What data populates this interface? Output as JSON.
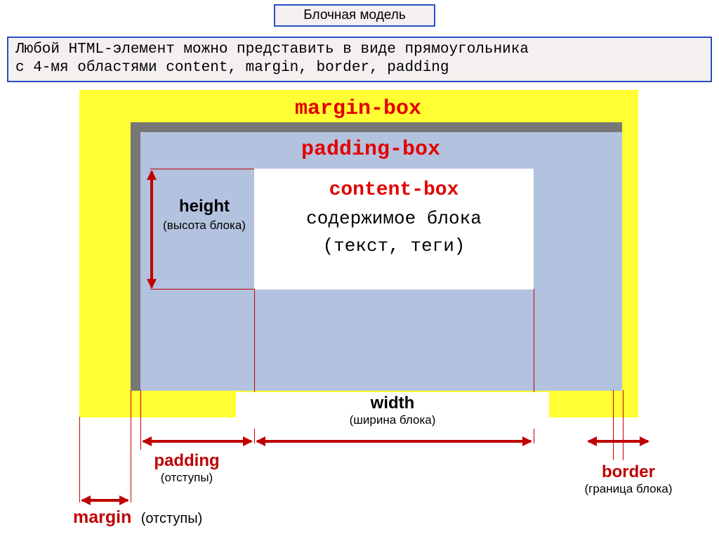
{
  "title": "Блочная модель",
  "description_line1": "Любой HTML-элемент можно представить в виде прямоугольника",
  "description_line2_prefix": "с 4-мя областями  ",
  "description_line2_terms": "content,  margin, border, padding",
  "labels": {
    "margin_box": "margin-box",
    "padding_box": "padding-box",
    "content_box_title": "content-box",
    "content_box_line1": "содержимое блока",
    "content_box_line2": "(текст, теги)"
  },
  "annotations": {
    "height": {
      "term": "height",
      "note": "(высота блока)"
    },
    "width": {
      "term": "width",
      "note": "(ширина блока)"
    },
    "padding": {
      "term": "padding",
      "note": "(отступы)"
    },
    "margin": {
      "term": "margin",
      "note": "(отступы)"
    },
    "border": {
      "term": "border",
      "note": "(граница блока)"
    }
  }
}
